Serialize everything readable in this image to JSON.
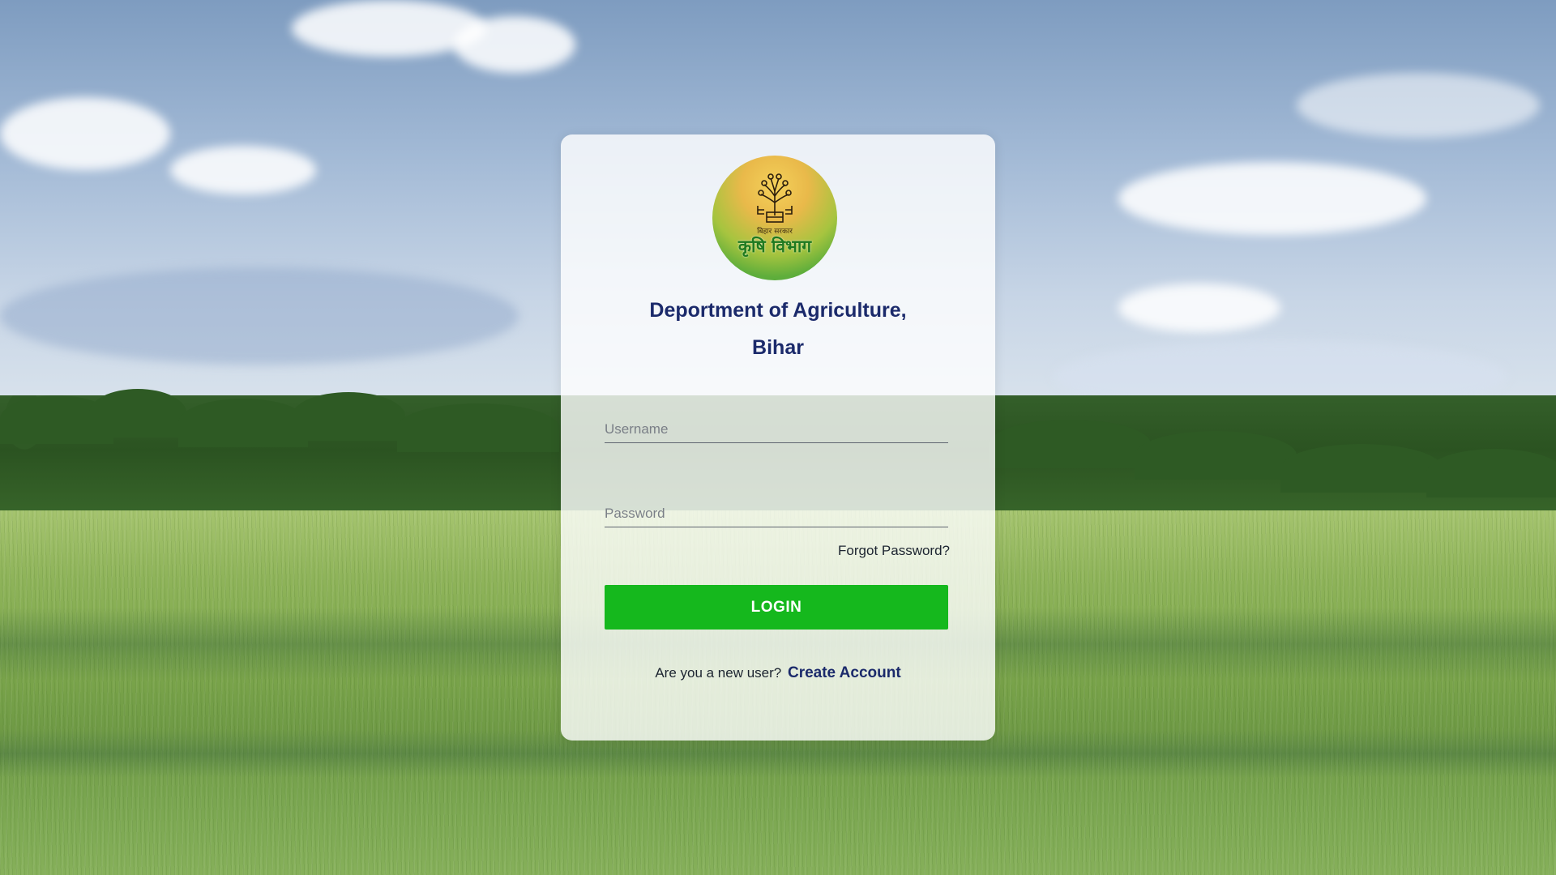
{
  "branding": {
    "logo_top_text": "बिहार सरकार",
    "logo_main_text": "कृषि विभाग",
    "title_line1": "Deportment of Agriculture,",
    "title_line2": "Bihar"
  },
  "login_form": {
    "username_placeholder": "Username",
    "username_value": "",
    "password_placeholder": "Password",
    "password_value": "",
    "forgot_password_label": "Forgot Password?",
    "login_label": "LOGIN",
    "new_user_prompt": "Are you a new user?",
    "create_account_label": "Create Account"
  },
  "colors": {
    "title": "#1b2a6b",
    "login_button": "#15b81d",
    "card_background": "rgba(255,255,255,0.80)"
  },
  "icons": {
    "logo": "bihar-agriculture-emblem"
  }
}
